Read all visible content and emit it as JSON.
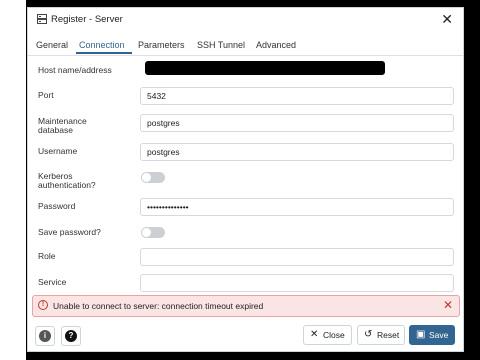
{
  "window": {
    "title": "Register - Server",
    "close_glyph": "✕"
  },
  "tabs": [
    {
      "label": "General",
      "active": false
    },
    {
      "label": "Connection",
      "active": true
    },
    {
      "label": "Parameters",
      "active": false
    },
    {
      "label": "SSH Tunnel",
      "active": false
    },
    {
      "label": "Advanced",
      "active": false
    }
  ],
  "fields": {
    "host": {
      "label": "Host name/address",
      "value": ""
    },
    "port": {
      "label": "Port",
      "value": "5432"
    },
    "maintenance_db": {
      "label_line1": "Maintenance",
      "label_line2": "database",
      "value": "postgres"
    },
    "username": {
      "label": "Username",
      "value": "postgres"
    },
    "kerberos": {
      "label_line1": "Kerberos",
      "label_line2": "authentication?",
      "enabled": false
    },
    "password": {
      "label": "Password",
      "value": "••••••••••••••"
    },
    "save_password": {
      "label": "Save password?",
      "enabled": false
    },
    "role": {
      "label": "Role",
      "value": ""
    },
    "service": {
      "label": "Service",
      "value": ""
    }
  },
  "error": {
    "message": "Unable to connect to server: connection timeout expired",
    "close_glyph": "✕"
  },
  "footer": {
    "info_glyph": "i",
    "help_glyph": "?",
    "close_label": "Close",
    "close_glyph": "✕",
    "reset_label": "Reset",
    "reset_glyph": "↺",
    "save_label": "Save",
    "save_glyph": "▣"
  },
  "colors": {
    "accent": "#326690",
    "error_bg": "#fbe4e4",
    "error_border": "#e6a4a4",
    "error_icon": "#c0392b"
  }
}
